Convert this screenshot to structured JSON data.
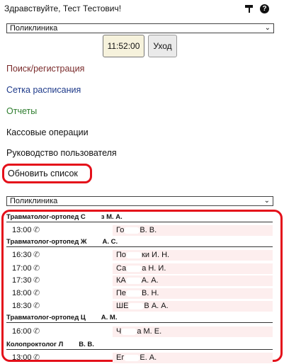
{
  "header": {
    "greeting": "Здравствуйте, Тест Тестович!",
    "icons": [
      "brush-icon",
      "help-icon"
    ]
  },
  "clinic_select_top": {
    "value": "Поликлиника"
  },
  "clock": {
    "time": "11:52:00"
  },
  "exit_button": {
    "label": "Уход"
  },
  "nav": {
    "search": "Поиск/регистрация",
    "schedule_grid": "Сетка расписания",
    "reports": "Отчеты",
    "cash_ops": "Кассовые операции",
    "manual": "Руководство пользователя",
    "refresh": "Обновить список"
  },
  "clinic_select_list": {
    "value": "Поликлиника"
  },
  "doctors": [
    {
      "title": "Травматолог-ортопед С",
      "suffix": "з М. А.",
      "appointments": [
        {
          "time": "13:00",
          "patient_a": "Го",
          "patient_b": "В. В."
        }
      ]
    },
    {
      "title": "Травматолог-ортопед Ж",
      "suffix": "А. С.",
      "appointments": [
        {
          "time": "16:30",
          "patient_a": "По",
          "patient_b": "ки И. Н."
        },
        {
          "time": "17:00",
          "patient_a": "Са",
          "patient_b": "а Н. И."
        },
        {
          "time": "17:30",
          "patient_a": "КА",
          "patient_b": "А. А."
        },
        {
          "time": "18:00",
          "patient_a": "Пе",
          "patient_b": "В. Н."
        },
        {
          "time": "18:30",
          "patient_a": "ШЕ",
          "patient_b": "В А. А."
        }
      ]
    },
    {
      "title": "Травматолог-ортопед Ц",
      "suffix": "А. М.",
      "appointments": [
        {
          "time": "16:00",
          "patient_a": "Ч",
          "patient_b": "а М. Е."
        }
      ]
    },
    {
      "title": "Колопроктолог Л",
      "suffix": "В. В.",
      "appointments": [
        {
          "time": "13:00",
          "patient_a": "Ег",
          "patient_b": "Е. А."
        }
      ]
    }
  ]
}
